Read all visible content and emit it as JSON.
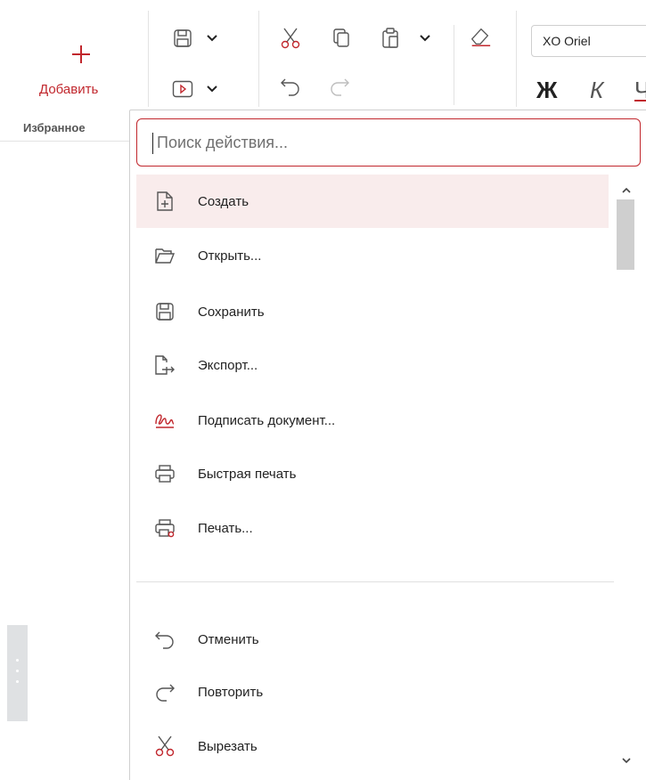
{
  "toolbar": {
    "add_label": "Добавить",
    "font_name": "XO Oriel",
    "bold_label": "Ж",
    "italic_label": "К",
    "underline_label": "Ч"
  },
  "left_panel": {
    "favorites_label": "Избранное"
  },
  "dropdown": {
    "search": {
      "placeholder": "Поиск действия...",
      "value": ""
    },
    "items": [
      {
        "label": "Создать",
        "icon": "new-document-icon",
        "active": true
      },
      {
        "label": "Открыть...",
        "icon": "folder-open-icon"
      },
      {
        "label": "Сохранить",
        "icon": "save-icon"
      },
      {
        "label": "Экспорт...",
        "icon": "export-icon"
      },
      {
        "label": "Подписать документ...",
        "icon": "signature-icon"
      },
      {
        "label": "Быстрая печать",
        "icon": "printer-icon"
      },
      {
        "label": "Печать...",
        "icon": "print-settings-icon"
      },
      {
        "label": "Отменить",
        "icon": "undo-icon"
      },
      {
        "label": "Повторить",
        "icon": "redo-icon"
      },
      {
        "label": "Вырезать",
        "icon": "scissors-icon"
      }
    ]
  },
  "colors": {
    "accent": "#c1272d",
    "active_item_bg": "#f9ecec",
    "icon_gray": "#555555",
    "scroll_thumb": "#cfcfcf",
    "panel_handle": "#dfe1e3"
  }
}
